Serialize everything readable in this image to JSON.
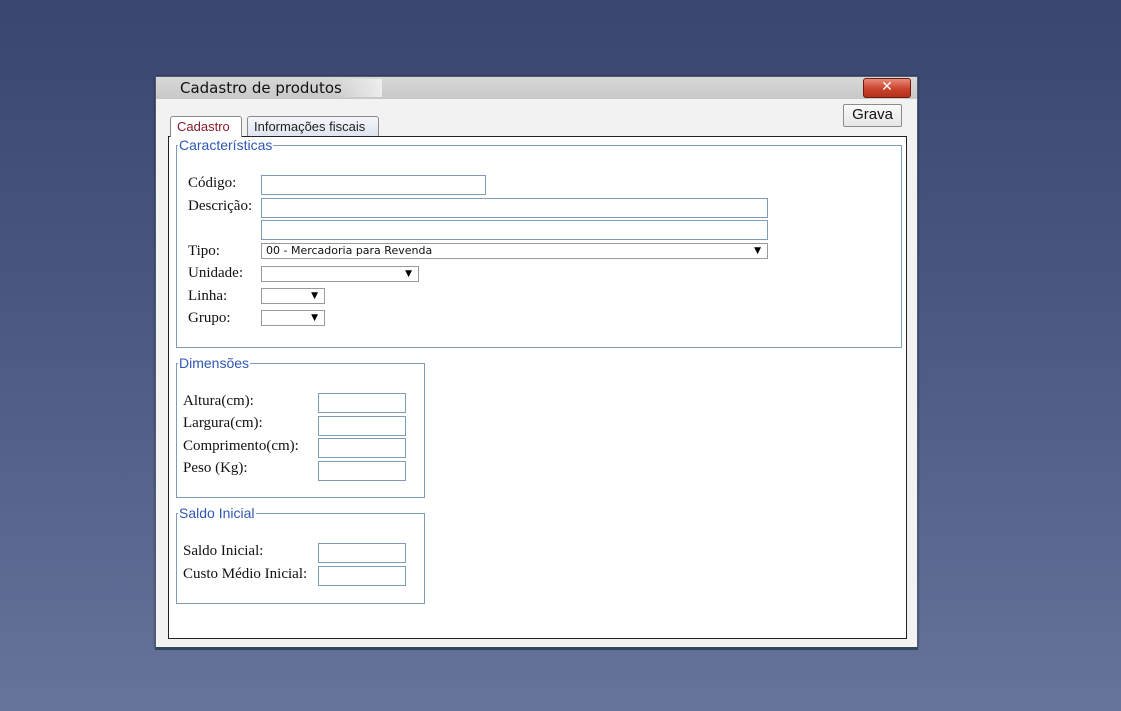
{
  "window": {
    "title": "Cadastro de produtos",
    "close_glyph": "✕"
  },
  "toolbar": {
    "save_label": "Grava"
  },
  "tabs": [
    {
      "label": "Cadastro",
      "active": true
    },
    {
      "label": "Informações fiscais",
      "active": false
    }
  ],
  "caracteristicas": {
    "legend": "Características",
    "codigo": {
      "label": "Código:",
      "value": ""
    },
    "descricao": {
      "label": "Descrição:",
      "value": "",
      "value2": ""
    },
    "tipo": {
      "label": "Tipo:",
      "selected": "00 - Mercadoria para Revenda"
    },
    "unidade": {
      "label": "Unidade:",
      "selected": ""
    },
    "linha": {
      "label": "Linha:",
      "selected": ""
    },
    "grupo": {
      "label": "Grupo:",
      "selected": ""
    }
  },
  "dimensoes": {
    "legend": "Dimensões",
    "altura": {
      "label": "Altura(cm):",
      "value": ""
    },
    "largura": {
      "label": "Largura(cm):",
      "value": ""
    },
    "comprimento": {
      "label": "Comprimento(cm):",
      "value": ""
    },
    "peso": {
      "label": "Peso (Kg):",
      "value": ""
    }
  },
  "saldo": {
    "legend": "Saldo Inicial",
    "saldo_inicial": {
      "label": "Saldo Inicial:",
      "value": ""
    },
    "custo_medio": {
      "label": "Custo Médio Inicial:",
      "value": ""
    }
  },
  "icons": {
    "dropdown_arrow": "▼"
  },
  "colors": {
    "legend_text": "#2e57b5",
    "active_tab_text": "#8a1a2a",
    "close_button": "#c9432b",
    "desktop_background": "#4b5884"
  }
}
